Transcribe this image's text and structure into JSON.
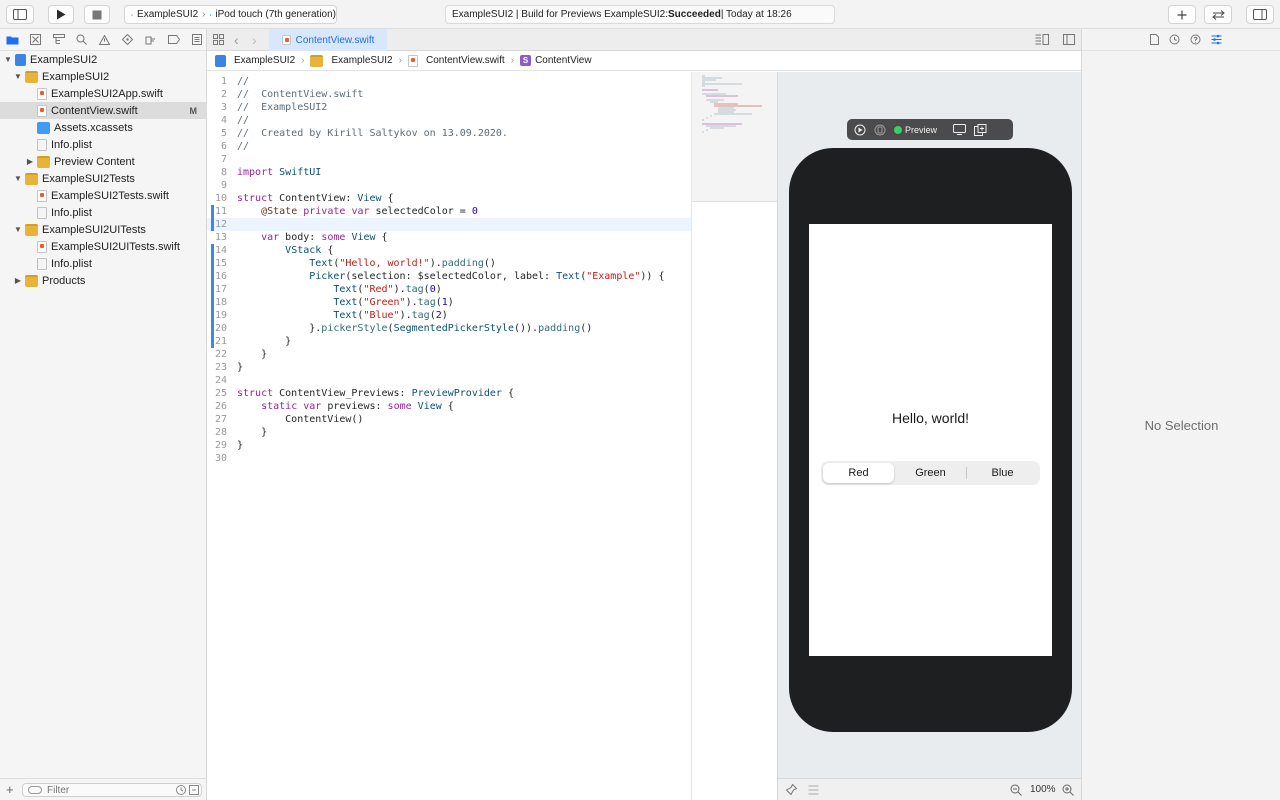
{
  "toolbar": {
    "scheme_target": "ExampleSUI2",
    "scheme_device": "iPod touch (7th generation)",
    "activity_prefix": "ExampleSUI2 | Build for Previews ExampleSUI2: ",
    "activity_status": "Succeeded",
    "activity_suffix": " | Today at 18:26"
  },
  "navigator": {
    "filter_placeholder": "Filter",
    "items": [
      {
        "label": "ExampleSUI2",
        "level": 0,
        "type": "project",
        "expanded": true
      },
      {
        "label": "ExampleSUI2",
        "level": 1,
        "type": "folder",
        "expanded": true
      },
      {
        "label": "ExampleSUI2App.swift",
        "level": 2,
        "type": "swift"
      },
      {
        "label": "ContentView.swift",
        "level": 2,
        "type": "swift",
        "selected": true,
        "badge": "M"
      },
      {
        "label": "Assets.xcassets",
        "level": 2,
        "type": "assets"
      },
      {
        "label": "Info.plist",
        "level": 2,
        "type": "plist"
      },
      {
        "label": "Preview Content",
        "level": 2,
        "type": "folder",
        "expanded": false
      },
      {
        "label": "ExampleSUI2Tests",
        "level": 1,
        "type": "folder",
        "expanded": true
      },
      {
        "label": "ExampleSUI2Tests.swift",
        "level": 2,
        "type": "swift"
      },
      {
        "label": "Info.plist",
        "level": 2,
        "type": "plist"
      },
      {
        "label": "ExampleSUI2UITests",
        "level": 1,
        "type": "folder",
        "expanded": true
      },
      {
        "label": "ExampleSUI2UITests.swift",
        "level": 2,
        "type": "swift"
      },
      {
        "label": "Info.plist",
        "level": 2,
        "type": "plist"
      },
      {
        "label": "Products",
        "level": 1,
        "type": "folder",
        "expanded": false
      }
    ]
  },
  "editor": {
    "tab_label": "ContentView.swift",
    "breadcrumbs": [
      "ExampleSUI2",
      "ExampleSUI2",
      "ContentView.swift",
      "ContentView"
    ],
    "current_line": 12,
    "lines": [
      "//",
      "//  ContentView.swift",
      "//  ExampleSUI2",
      "//",
      "//  Created by Kirill Saltykov on 13.09.2020.",
      "//",
      "",
      "import SwiftUI",
      "",
      "struct ContentView: View {",
      "    @State private var selectedColor = 0",
      "",
      "    var body: some View {",
      "        VStack {",
      "            Text(\"Hello, world!\").padding()",
      "            Picker(selection: $selectedColor, label: Text(\"Example\")) {",
      "                Text(\"Red\").tag(0)",
      "                Text(\"Green\").tag(1)",
      "                Text(\"Blue\").tag(2)",
      "            }.pickerStyle(SegmentedPickerStyle()).padding()",
      "        }",
      "    }",
      "}",
      "",
      "struct ContentView_Previews: PreviewProvider {",
      "    static var previews: some View {",
      "        ContentView()",
      "    }",
      "}",
      ""
    ]
  },
  "canvas": {
    "preview_label": "Preview",
    "hello_text": "Hello, world!",
    "picker_options": [
      "Red",
      "Green",
      "Blue"
    ],
    "picker_selected": 0,
    "zoom": "100%"
  },
  "inspector": {
    "empty_text": "No Selection"
  },
  "colors": {
    "accent": "#1f6ff0",
    "status_green": "#3ad060",
    "device_bezel": "#1e1f21"
  }
}
